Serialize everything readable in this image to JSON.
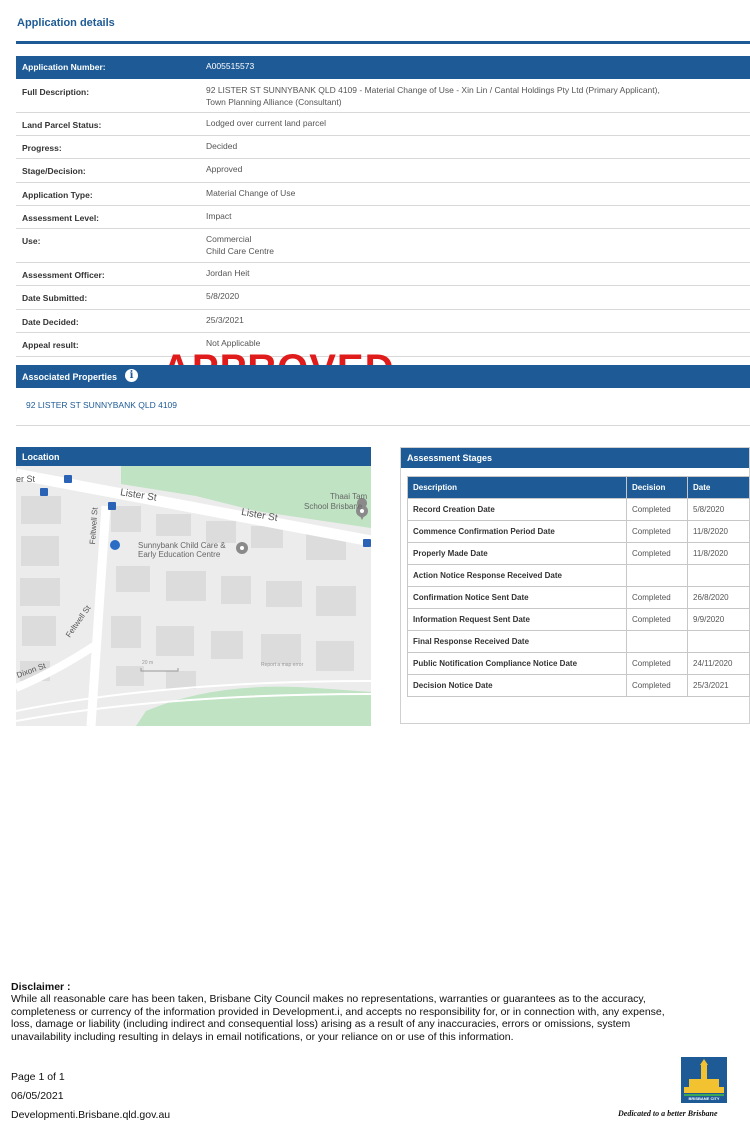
{
  "header": {
    "title": "Application details"
  },
  "details": {
    "rows": [
      {
        "label": "Application Number:",
        "value": "A005515573"
      },
      {
        "label": "Full Description:",
        "value": "92 LISTER ST SUNNYBANK QLD 4109 - Material Change of Use - Xin Lin / Cantal Holdings Pty Ltd (Primary Applicant),",
        "value2": "Town Planning Alliance (Consultant)"
      },
      {
        "label": "Land Parcel Status:",
        "value": "Lodged over current land parcel"
      },
      {
        "label": "Progress:",
        "value": "Decided"
      },
      {
        "label": "Stage/Decision:",
        "value": "Approved"
      },
      {
        "label": "Application Type:",
        "value": "Material Change of Use"
      },
      {
        "label": "Assessment Level:",
        "value": "Impact"
      },
      {
        "label": "Use:",
        "value": "Commercial",
        "value2": "Child Care Centre"
      },
      {
        "label": "Assessment Officer:",
        "value": "Jordan Heit"
      },
      {
        "label": "Date Submitted:",
        "value": "5/8/2020"
      },
      {
        "label": "Date Decided:",
        "value": "25/3/2021"
      },
      {
        "label": "Appeal result:",
        "value": "Not Applicable"
      }
    ]
  },
  "stamp": "APPROVED",
  "associated": {
    "title": "Associated Properties",
    "info_icon": "info-icon",
    "address": "92 LISTER ST SUNNYBANK QLD 4109"
  },
  "location": {
    "title": "Location",
    "labels": {
      "lister1": "Lister St",
      "lister2": "Lister St",
      "er": "er St",
      "felt1": "Feltwell St",
      "felt2": "Feltwell St",
      "dixon": "Dixon St",
      "school1": "Thaai Tam",
      "school2": "School Brisbane",
      "child1": "Sunnybank Child Care &",
      "child2": "Early Education Centre",
      "scale": "20 m",
      "report": "Report a map error"
    }
  },
  "stages": {
    "title": "Assessment Stages",
    "columns": [
      "Description",
      "Decision",
      "Date"
    ],
    "rows": [
      [
        "Record Creation Date",
        "Completed",
        "5/8/2020"
      ],
      [
        "Commence Confirmation Period Date",
        "Completed",
        "11/8/2020"
      ],
      [
        "Properly Made Date",
        "Completed",
        "11/8/2020"
      ],
      [
        "Action Notice Response Received Date",
        "",
        ""
      ],
      [
        "Confirmation Notice Sent Date",
        "Completed",
        "26/8/2020"
      ],
      [
        "Information Request Sent Date",
        "Completed",
        "9/9/2020"
      ],
      [
        "Final Response Received Date",
        "",
        ""
      ],
      [
        "Public Notification Compliance Notice Date",
        "Completed",
        "24/11/2020"
      ],
      [
        "Decision Notice Date",
        "Completed",
        "25/3/2021"
      ]
    ]
  },
  "footer": {
    "disclaimer_title": "Disclaimer :",
    "disclaimer_lines": [
      "While all reasonable care has been taken, Brisbane City Council makes no representations, warranties or guarantees as to the accuracy,",
      "completeness or currency of the information provided in Development.i, and accepts no responsibility for, or in connection with, any expense,",
      "loss, damage or liability (including indirect and consequential loss) arising as a result of any inaccuracies, errors or omissions, system",
      "unavailability including resulting in delays in email notifications, or your reliance on or use of this information."
    ],
    "page": "Page 1 of 1",
    "date": "06/05/2021",
    "site": "Developmenti.Brisbane.qld.gov.au",
    "logo_text": "BRISBANE CITY",
    "tagline": "Dedicated to a better Brisbane"
  }
}
